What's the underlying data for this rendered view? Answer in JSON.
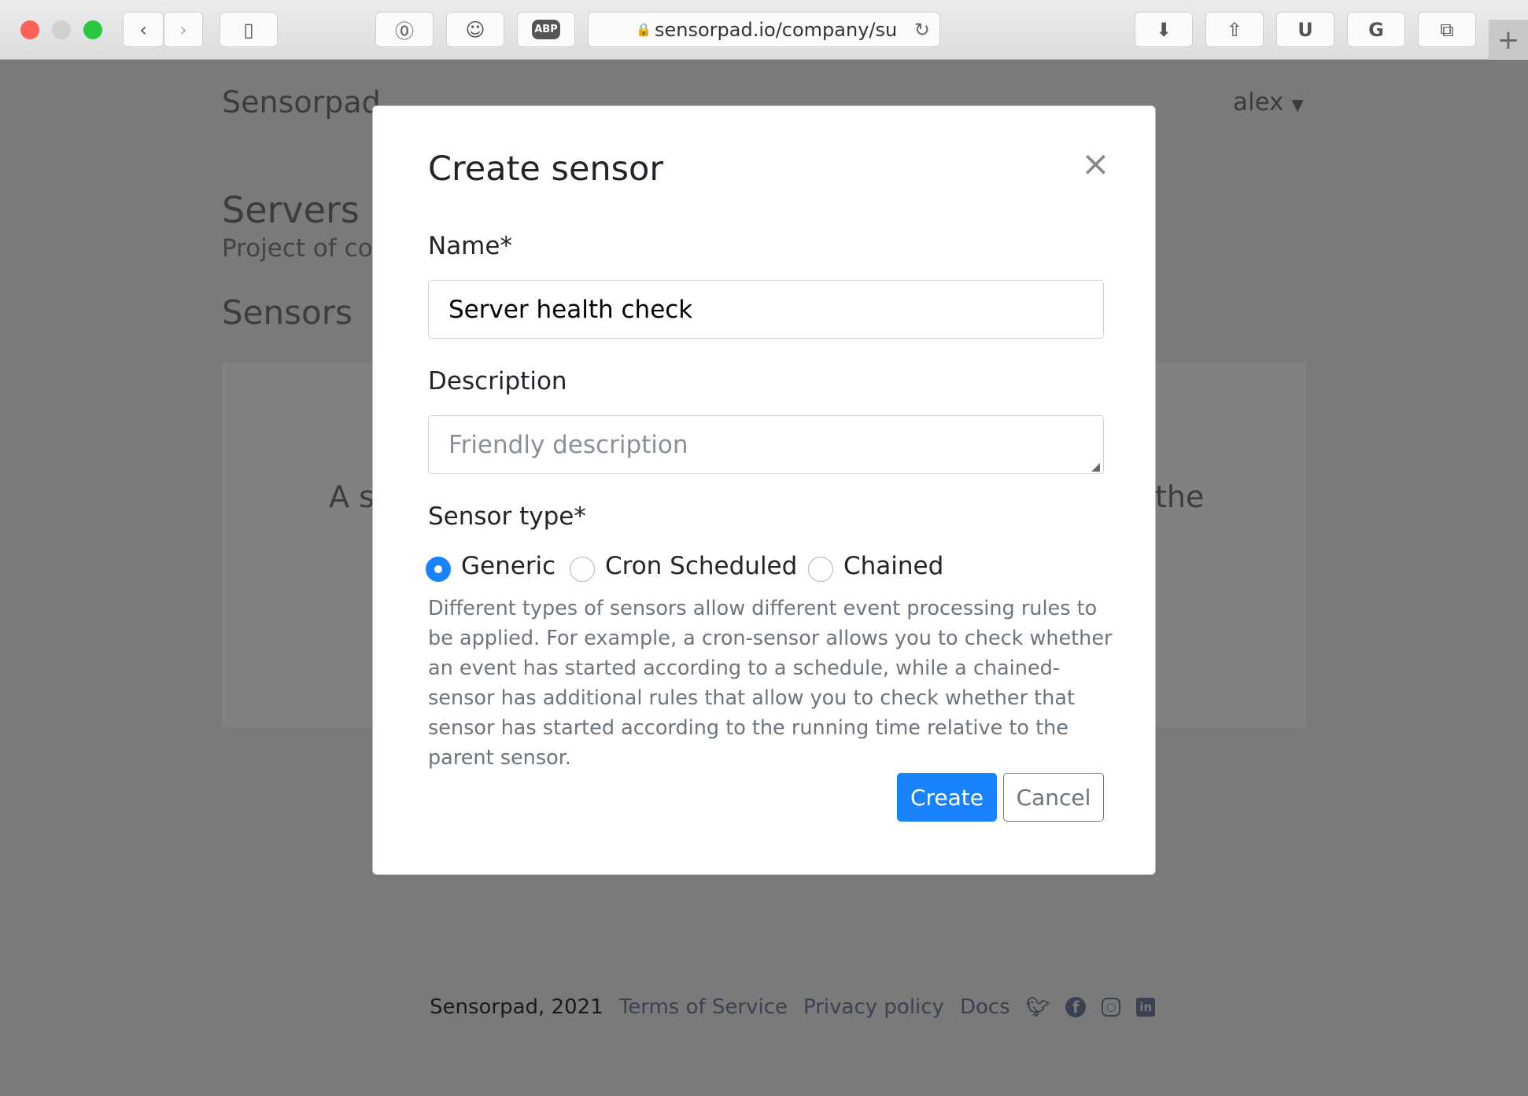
{
  "browser": {
    "url": "sensorpad.io/company/su"
  },
  "page": {
    "brand": "Sensorpad",
    "user": "alex",
    "title": "Servers",
    "subtitle": "Project of con",
    "section": "Sensors",
    "empty_left": "A s",
    "empty_right": "the"
  },
  "modal": {
    "title": "Create sensor",
    "name_label": "Name*",
    "name_value": "Server health check",
    "description_label": "Description",
    "description_placeholder": "Friendly description",
    "type_label": "Sensor type*",
    "types": [
      {
        "label": "Generic",
        "selected": true
      },
      {
        "label": "Cron Scheduled",
        "selected": false
      },
      {
        "label": "Chained",
        "selected": false
      }
    ],
    "help": "Different types of sensors allow different event processing rules to be applied. For example, a cron-sensor allows you to check whether an event has started according to a schedule, while a chained-sensor has additional rules that allow you to check whether that sensor has started according to the running time relative to the parent sensor.",
    "create": "Create",
    "cancel": "Cancel"
  },
  "footer": {
    "copyright": "Sensorpad, 2021",
    "links": [
      "Terms of Service",
      "Privacy policy",
      "Docs"
    ],
    "social": [
      "twitter-icon",
      "facebook-icon",
      "instagram-icon",
      "linkedin-icon"
    ]
  },
  "colors": {
    "primary": "#1a82fb",
    "overlay": "#7a7a7a"
  }
}
